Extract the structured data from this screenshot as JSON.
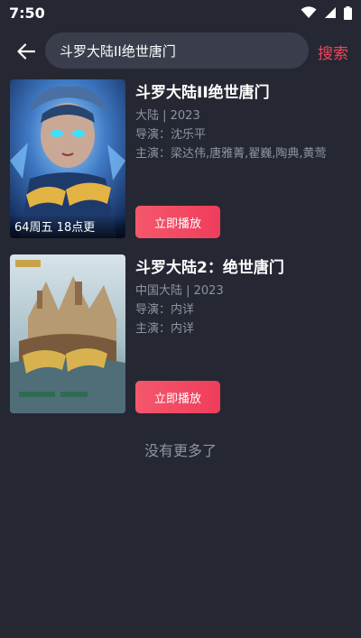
{
  "status_bar": {
    "time": "7:50",
    "icons": [
      "wifi-icon",
      "signal-icon",
      "battery-icon"
    ]
  },
  "search": {
    "value": "斗罗大陆II绝世唐门",
    "placeholder": "",
    "submit_label": "搜索"
  },
  "results": [
    {
      "title": "斗罗大陆II绝世唐门",
      "region_year": "大陆 | 2023",
      "director": "导演：沈乐平",
      "cast": "主演：梁达伟,唐雅菁,翟巍,陶典,黄莺",
      "poster_caption": "64周五 18点更",
      "play_label": "立即播放"
    },
    {
      "title": "斗罗大陆2：绝世唐门",
      "region_year": "中国大陆 | 2023",
      "director": "导演：内详",
      "cast": "主演：内详",
      "play_label": "立即播放"
    }
  ],
  "end_text": "没有更多了",
  "colors": {
    "background": "#252833",
    "search_box": "#3a3e4c",
    "accent": "#f0435d",
    "muted_text": "#8f93a0"
  }
}
